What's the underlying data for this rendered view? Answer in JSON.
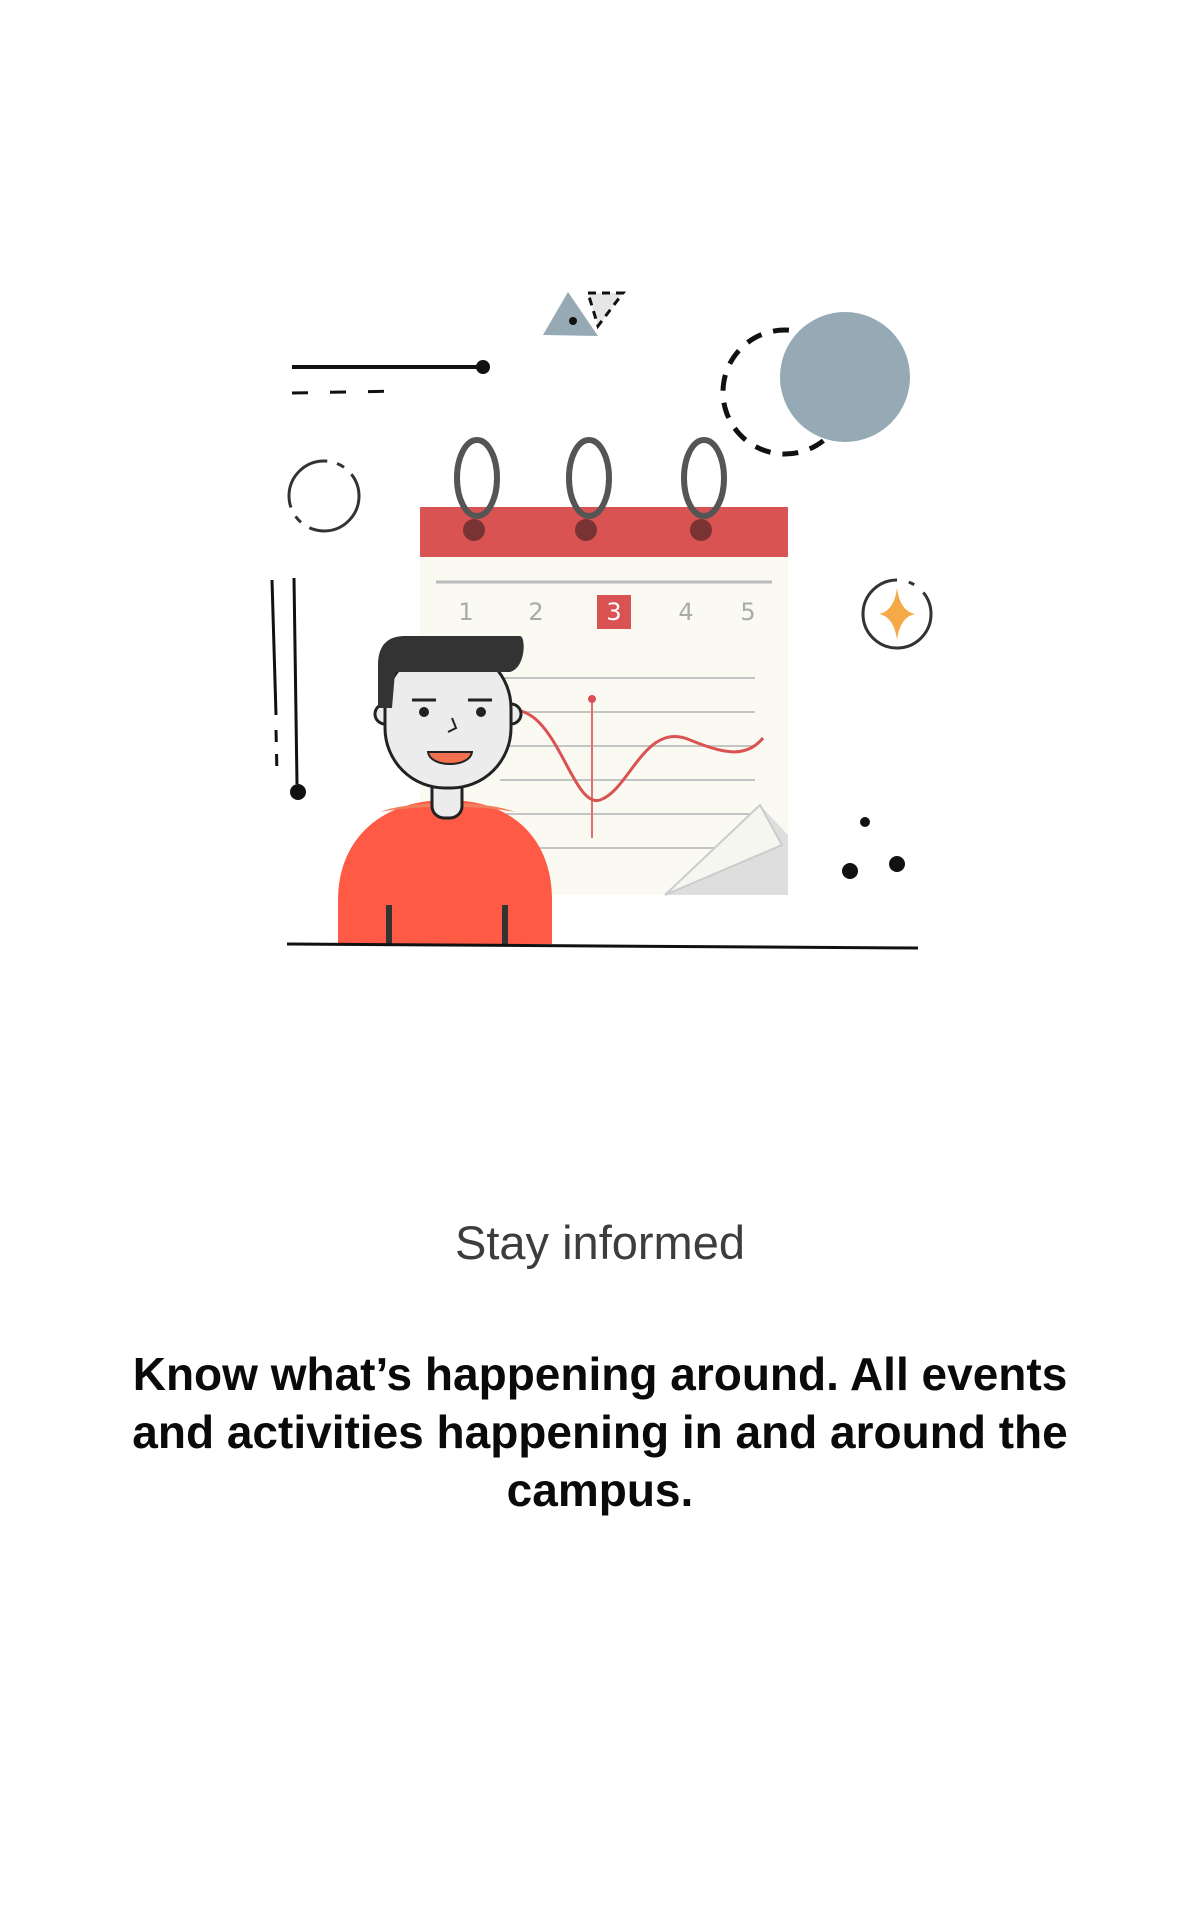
{
  "onboarding": {
    "title": "Stay informed",
    "description": "Know what’s happening around. All events and activities happening in and around the campus."
  },
  "illustration": {
    "icon": "calendar-person-illustration",
    "calendar_days": [
      "1",
      "2",
      "3",
      "4",
      "5"
    ],
    "highlighted_day": "3",
    "colors": {
      "calendar_header": "#d95353",
      "shirt": "#ff5a45",
      "circle": "#95aab4",
      "sparkle": "#f5a947"
    }
  }
}
